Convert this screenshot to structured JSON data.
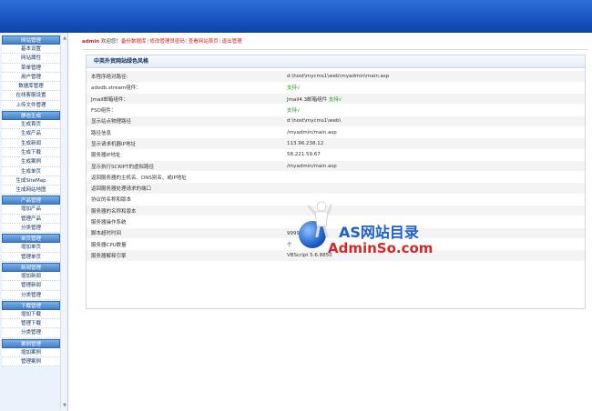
{
  "sidebar": {
    "groups": [
      {
        "title": "网站管理",
        "items": [
          "基本设置",
          "网站属性",
          "菜单管理",
          "用户管理",
          "数据库管理",
          "在线客服设置",
          "上传文件管理"
        ]
      },
      {
        "title": "静态生成",
        "items": [
          "生成首页",
          "生成产品",
          "生成新闻",
          "生成下载",
          "生成案例",
          "生成单页",
          "生成SiteMap",
          "生成网站地图"
        ]
      },
      {
        "title": "产品管理",
        "items": [
          "增加产品",
          "管理产品",
          "分类管理"
        ]
      },
      {
        "title": "单页管理",
        "items": [
          "增加单页",
          "管理单页"
        ]
      },
      {
        "title": "新闻管理",
        "items": [
          "增加新闻",
          "管理新闻",
          "分类管理"
        ]
      },
      {
        "title": "下载管理",
        "items": [
          "增加下载",
          "管理下载",
          "分类管理"
        ]
      },
      {
        "title": "案例管理",
        "items": [
          "增加案例",
          "管理案例"
        ]
      }
    ]
  },
  "topnav": {
    "admin": "admin",
    "welcome": " 欢迎您！",
    "links": [
      "备份数据库",
      "修改管理员密码",
      "查看网站首页",
      "退出管理"
    ],
    "sep": "|"
  },
  "panel": {
    "title": "中英外贸网站绿色风格",
    "rows": [
      {
        "k": "本程序绝对路径:",
        "v": "d:\\host\\mycms1\\web\\myadmin\\main.asp"
      },
      {
        "k": "adodb.stream组件：",
        "v": "支持√",
        "ok": true
      },
      {
        "k": "Jmail邮箱组件：",
        "v": "Jmail4.3邮箱组件",
        "v2": " 支持√"
      },
      {
        "k": "FSO组件：",
        "v": "支持√",
        "ok": true
      },
      {
        "k": "显示站点物理路径",
        "v": "d:\\host\\mycms1\\web\\"
      },
      {
        "k": "路径信息",
        "v": "/myadmin/main.asp"
      },
      {
        "k": "显示请求机器IP地址",
        "v": "113.96.238.12"
      },
      {
        "k": "服务器IP地址",
        "v": "58.221.59.67"
      },
      {
        "k": "显示执行SCRIPT的虚拟路径",
        "v": "/myadmin/main.asp"
      },
      {
        "k": "返回服务器的主机名、DNS别名、或IP地址",
        "v": ""
      },
      {
        "k": "返回服务器处理请求的端口",
        "v": ""
      },
      {
        "k": "协议的名称和版本",
        "v": ""
      },
      {
        "k": "服务器的名称和版本",
        "v": ""
      },
      {
        "k": "服务器操作系统",
        "v": ""
      },
      {
        "k": "脚本超时时间",
        "v": "999999秒"
      },
      {
        "k": "服务器CPU数量",
        "v": "个"
      },
      {
        "k": "服务器解释引擎",
        "v": "VBScript 5.6.8850"
      }
    ]
  },
  "watermark": {
    "line1": "AS网站目录",
    "line2": "AdminSo.com"
  },
  "colors": {
    "topbar": "#1b56c2",
    "accent": "#cc1e1e",
    "ok": "#1aa01a"
  }
}
